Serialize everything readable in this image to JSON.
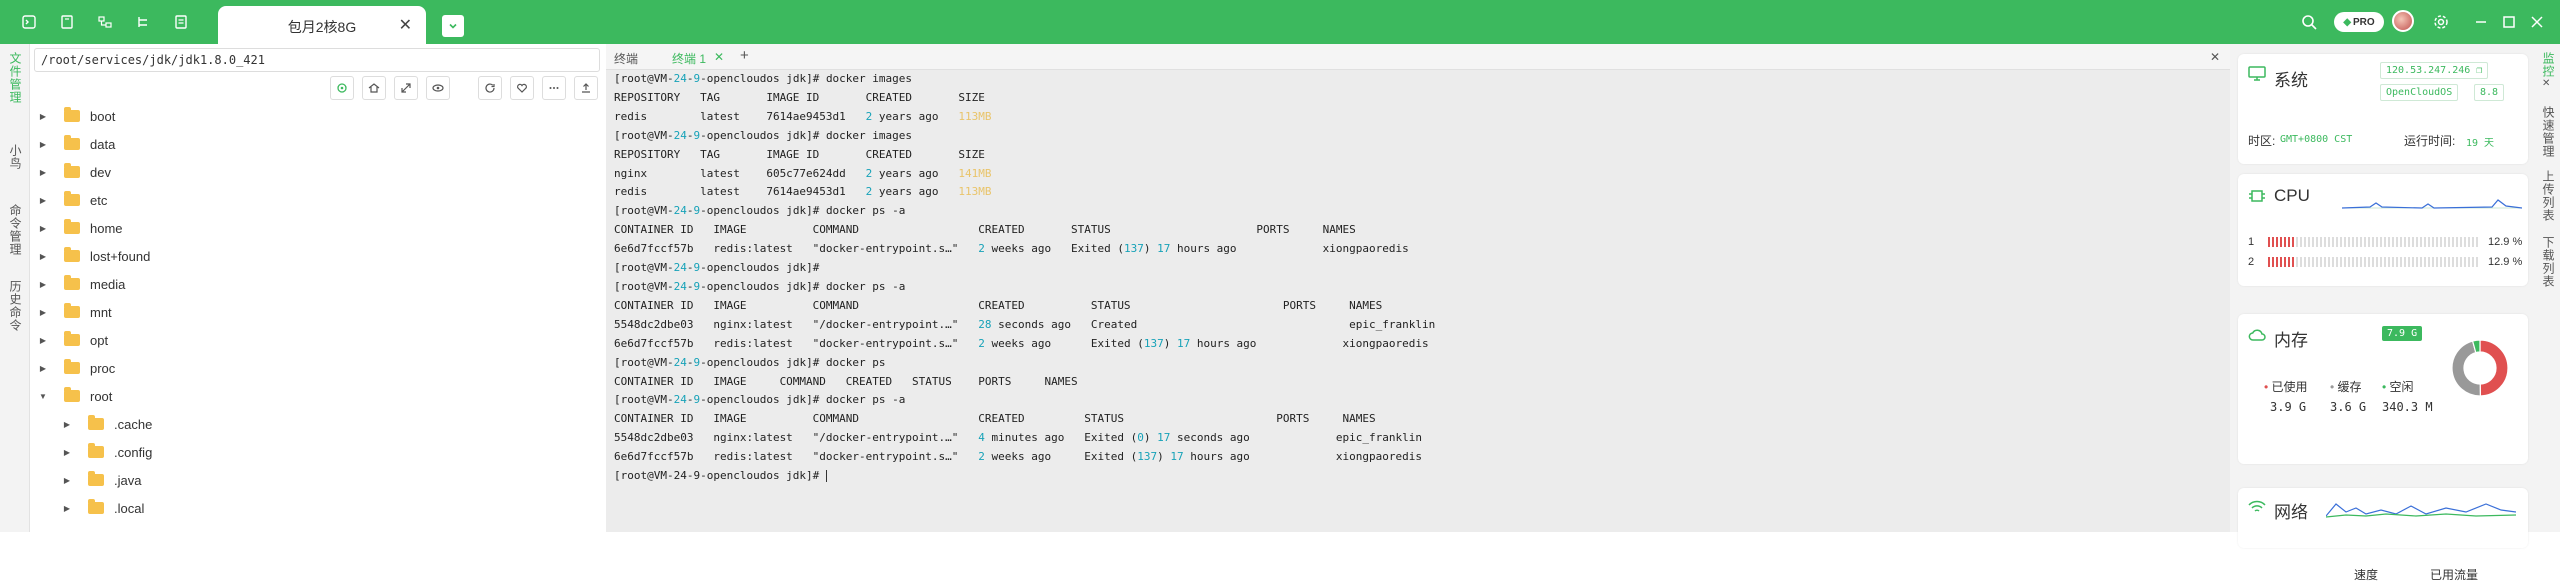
{
  "app": {
    "active_tab": "包月2核8G",
    "close_symbol": "✕",
    "pro_label": "PRO"
  },
  "sidebar_tabs": [
    "文件管理",
    "小鸟",
    "命令管理",
    "历史命令"
  ],
  "file_panel": {
    "path": "/root/services/jdk/jdk1.8.0_421",
    "tree": [
      {
        "name": "boot",
        "level": 0,
        "expanded": false
      },
      {
        "name": "data",
        "level": 0,
        "expanded": false
      },
      {
        "name": "dev",
        "level": 0,
        "expanded": false
      },
      {
        "name": "etc",
        "level": 0,
        "expanded": false
      },
      {
        "name": "home",
        "level": 0,
        "expanded": false
      },
      {
        "name": "lost+found",
        "level": 0,
        "expanded": false
      },
      {
        "name": "media",
        "level": 0,
        "expanded": false
      },
      {
        "name": "mnt",
        "level": 0,
        "expanded": false
      },
      {
        "name": "opt",
        "level": 0,
        "expanded": false
      },
      {
        "name": "proc",
        "level": 0,
        "expanded": false
      },
      {
        "name": "root",
        "level": 0,
        "expanded": true
      },
      {
        "name": ".cache",
        "level": 1,
        "expanded": false
      },
      {
        "name": ".config",
        "level": 1,
        "expanded": false
      },
      {
        "name": ".java",
        "level": 1,
        "expanded": false
      },
      {
        "name": ".local",
        "level": 1,
        "expanded": false
      }
    ]
  },
  "terminal": {
    "tabs": [
      {
        "label": "终端"
      },
      {
        "label": "终端 1"
      }
    ],
    "lines": [
      [
        {
          "t": "[root@VM-"
        },
        {
          "t": "24",
          "c": "g"
        },
        {
          "t": "-"
        },
        {
          "t": "9",
          "c": "g"
        },
        {
          "t": "-opencloudos jdk]# docker images"
        }
      ],
      [
        {
          "t": "REPOSITORY   TAG       IMAGE ID       CREATED       SIZE"
        }
      ],
      [
        {
          "t": "redis        latest    7614ae9453d1   "
        },
        {
          "t": "2",
          "c": "g"
        },
        {
          "t": " years ago   "
        },
        {
          "t": "113MB",
          "c": "y"
        }
      ],
      [
        {
          "t": "[root@VM-"
        },
        {
          "t": "24",
          "c": "g"
        },
        {
          "t": "-"
        },
        {
          "t": "9",
          "c": "g"
        },
        {
          "t": "-opencloudos jdk]# docker images"
        }
      ],
      [
        {
          "t": "REPOSITORY   TAG       IMAGE ID       CREATED       SIZE"
        }
      ],
      [
        {
          "t": "nginx        latest    605c77e624dd   "
        },
        {
          "t": "2",
          "c": "g"
        },
        {
          "t": " years ago   "
        },
        {
          "t": "141MB",
          "c": "y"
        }
      ],
      [
        {
          "t": "redis        latest    7614ae9453d1   "
        },
        {
          "t": "2",
          "c": "g"
        },
        {
          "t": " years ago   "
        },
        {
          "t": "113MB",
          "c": "y"
        }
      ],
      [
        {
          "t": "[root@VM-"
        },
        {
          "t": "24",
          "c": "g"
        },
        {
          "t": "-"
        },
        {
          "t": "9",
          "c": "g"
        },
        {
          "t": "-opencloudos jdk]# docker ps -a"
        }
      ],
      [
        {
          "t": "CONTAINER ID   IMAGE          COMMAND                  CREATED       STATUS                      PORTS     NAMES"
        }
      ],
      [
        {
          "t": "6e6d7fccf57b   redis:latest   \"docker-entrypoint.s…\"   "
        },
        {
          "t": "2",
          "c": "g"
        },
        {
          "t": " weeks ago   Exited ("
        },
        {
          "t": "137",
          "c": "g"
        },
        {
          "t": ") "
        },
        {
          "t": "17",
          "c": "g"
        },
        {
          "t": " hours ago             xiongpaoredis"
        }
      ],
      [
        {
          "t": "[root@VM-"
        },
        {
          "t": "24",
          "c": "g"
        },
        {
          "t": "-"
        },
        {
          "t": "9",
          "c": "g"
        },
        {
          "t": "-opencloudos jdk]#"
        }
      ],
      [
        {
          "t": "[root@VM-"
        },
        {
          "t": "24",
          "c": "g"
        },
        {
          "t": "-"
        },
        {
          "t": "9",
          "c": "g"
        },
        {
          "t": "-opencloudos jdk]# docker ps -a"
        }
      ],
      [
        {
          "t": "CONTAINER ID   IMAGE          COMMAND                  CREATED          STATUS                       PORTS     NAMES"
        }
      ],
      [
        {
          "t": "5548dc2dbe03   nginx:latest   \"/docker-entrypoint.…\"   "
        },
        {
          "t": "28",
          "c": "g"
        },
        {
          "t": " seconds ago   Created                                epic_franklin"
        }
      ],
      [
        {
          "t": "6e6d7fccf57b   redis:latest   \"docker-entrypoint.s…\"   "
        },
        {
          "t": "2",
          "c": "g"
        },
        {
          "t": " weeks ago      Exited ("
        },
        {
          "t": "137",
          "c": "g"
        },
        {
          "t": ") "
        },
        {
          "t": "17",
          "c": "g"
        },
        {
          "t": " hours ago             xiongpaoredis"
        }
      ],
      [
        {
          "t": "[root@VM-"
        },
        {
          "t": "24",
          "c": "g"
        },
        {
          "t": "-"
        },
        {
          "t": "9",
          "c": "g"
        },
        {
          "t": "-opencloudos jdk]# docker ps"
        }
      ],
      [
        {
          "t": "CONTAINER ID   IMAGE     COMMAND   CREATED   STATUS    PORTS     NAMES"
        }
      ],
      [
        {
          "t": "[root@VM-"
        },
        {
          "t": "24",
          "c": "g"
        },
        {
          "t": "-"
        },
        {
          "t": "9",
          "c": "g"
        },
        {
          "t": "-opencloudos jdk]# docker ps -a"
        }
      ],
      [
        {
          "t": "CONTAINER ID   IMAGE          COMMAND                  CREATED         STATUS                       PORTS     NAMES"
        }
      ],
      [
        {
          "t": "5548dc2dbe03   nginx:latest   \"/docker-entrypoint.…\"   "
        },
        {
          "t": "4",
          "c": "g"
        },
        {
          "t": " minutes ago   Exited ("
        },
        {
          "t": "0",
          "c": "g"
        },
        {
          "t": ") "
        },
        {
          "t": "17",
          "c": "g"
        },
        {
          "t": " seconds ago             epic_franklin"
        }
      ],
      [
        {
          "t": "6e6d7fccf57b   redis:latest   \"docker-entrypoint.s…\"   "
        },
        {
          "t": "2",
          "c": "g"
        },
        {
          "t": " weeks ago     Exited ("
        },
        {
          "t": "137",
          "c": "g"
        },
        {
          "t": ") "
        },
        {
          "t": "17",
          "c": "g"
        },
        {
          "t": " hours ago             xiongpaoredis"
        }
      ],
      [
        {
          "t": "[root@VM-24-9-opencloudos jdk]# "
        }
      ]
    ]
  },
  "system": {
    "title": "系统",
    "ip": "120.53.247.246",
    "os": "OpenCloudOS",
    "os_version": "8.8",
    "timezone_label": "时区:",
    "timezone_value": "GMT+0800  CST",
    "uptime_label": "运行时间:",
    "uptime_value": "19 天"
  },
  "cpu": {
    "title": "CPU",
    "cores": [
      {
        "label": "1",
        "percent": 12.9,
        "text": "12.9 %"
      },
      {
        "label": "2",
        "percent": 12.9,
        "text": "12.9 %"
      }
    ]
  },
  "memory": {
    "title": "内存",
    "total": "7.9 G",
    "legend": [
      {
        "label": "已使用",
        "value": "3.9 G",
        "color": "#e05050"
      },
      {
        "label": "缓存",
        "value": "3.6 G",
        "color": "#999999"
      },
      {
        "label": "空闲",
        "value": "340.3 M",
        "color": "#3cb95e"
      }
    ]
  },
  "network": {
    "title": "网络",
    "col1": "速度",
    "col2": "已用流量"
  },
  "right_tabs": [
    "监控",
    "快速管理",
    "上传列表",
    "下载列表"
  ],
  "colors": {
    "accent": "#3cb95e",
    "prompt_num": "#17a2b8",
    "size": "#e9c46a",
    "cpu_bar": "#e05050"
  }
}
